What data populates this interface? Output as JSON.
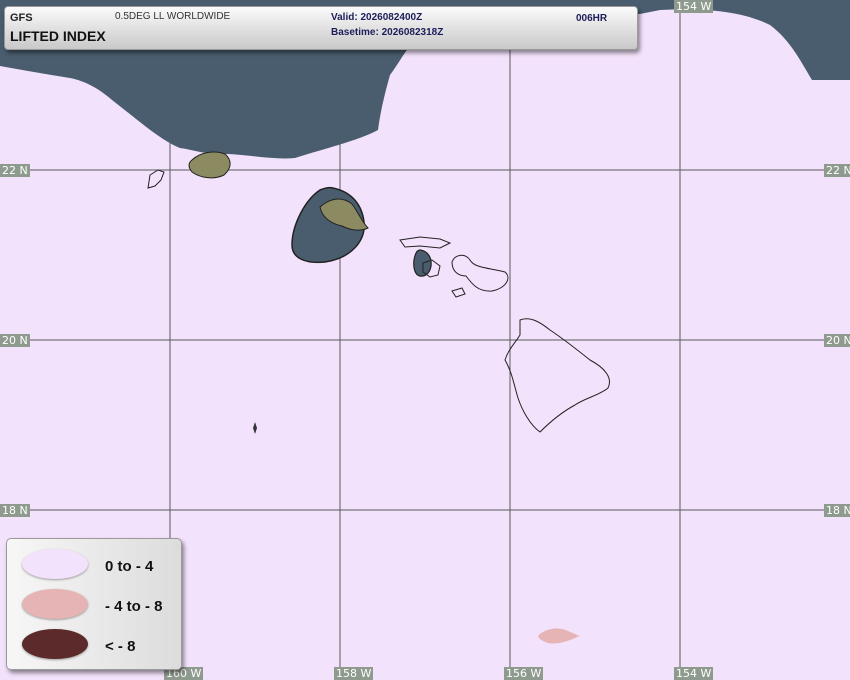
{
  "header": {
    "model": "GFS",
    "grid": "0.5DEG LL WORLDWIDE",
    "product": "LIFTED INDEX",
    "valid": "Valid: 2026082400Z",
    "basetime": "Basetime: 2026082318Z",
    "forecast_hour": "006HR"
  },
  "map": {
    "region": "Hawaiian Islands",
    "colors": {
      "background": "#f3e2fb",
      "stable_region": "#4a5d6e",
      "land_fill": "#8b8a60",
      "coastline": "#222222",
      "grid": "#5a5a5a",
      "tick_label_bg": "#8f9a8f"
    },
    "latitude_labels": [
      "22 N",
      "22 N",
      "20 N",
      "20 N",
      "18 N",
      "18 N"
    ],
    "longitude_labels_top": [
      "154 W"
    ],
    "longitude_labels_bottom": [
      "160 W",
      "158 W",
      "156 W",
      "154 W"
    ]
  },
  "legend": {
    "items": [
      {
        "label": "0 to - 4",
        "color": "#f3e2fb"
      },
      {
        "label": "- 4 to - 8",
        "color": "#e6b4b4"
      },
      {
        "label": "< - 8",
        "color": "#5c2a2a"
      }
    ]
  }
}
